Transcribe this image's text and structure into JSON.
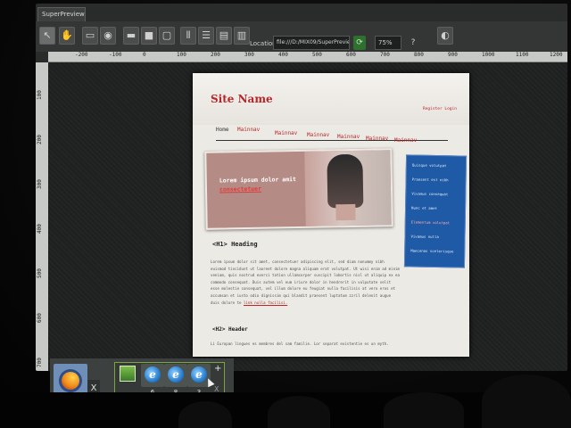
{
  "window": {
    "title": "SuperPreview"
  },
  "toolbar": {
    "location_label": "Location:",
    "location_value": "file:///D:/MIX09/SuperPreview/Site",
    "go_label": "⟳",
    "zoom_value": "75%",
    "help_label": "?"
  },
  "ruler": {
    "h_ticks": [
      "-200",
      "-100",
      "0",
      "100",
      "200",
      "300",
      "400",
      "500",
      "600",
      "700",
      "800",
      "900",
      "1000",
      "1100",
      "1200"
    ],
    "v_ticks": [
      "100",
      "200",
      "300",
      "400",
      "500",
      "600",
      "700"
    ]
  },
  "site": {
    "name": "Site Name",
    "register_login": "Register  Login",
    "nav": [
      "Home",
      "Mainnav",
      "Mainnav",
      "Mainnav",
      "Mainnav",
      "Mainnav",
      "Mainnav"
    ],
    "hero_text": "Lorem ipsum dolor amit ",
    "hero_link": "consectetuer",
    "sidebar_items": [
      "Quisque volutpat",
      "Praesent est nibh",
      "Vivamus consequat",
      "Nunc et amet",
      "Elementum volutpat",
      "Vivamus nulla",
      "Maecenas scelerisque"
    ],
    "h1": "<H1> Heading",
    "body": "Lorem ipsum dolor sit amet, consectetuer adipiscing elit, sed diam nonummy nibh euismod tincidunt ut laoreet dolore magna aliquam erat volutpat. Ut wisi enim ad minim veniam, quis nostrud exerci tation ullamcorper suscipit lobortis nisl ut aliquip ex ea commodo consequat. Duis autem vel eum iriure dolor in hendrerit in vulputate velit esse molestie consequat, vel illum dolore eu feugiat nulla facilisis at vero eros et accumsan et iusto odio dignissim qui blandit praesent luptatum zzril delenit augue duis dolore te ",
    "body_link": "link nulla facilisi.",
    "h2": "<H2> Header",
    "body2": "Li Europan lingues es membres del sam familie. Lor separat existentie es un myth."
  },
  "taskbar": {
    "firefox_close": "X",
    "ie_versions": [
      "6",
      "8",
      "3"
    ],
    "add_label": "+",
    "group_close": "X"
  }
}
